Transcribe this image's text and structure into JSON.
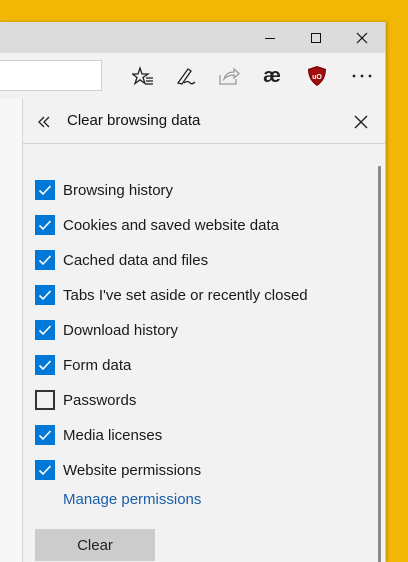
{
  "pane": {
    "title": "Clear browsing data"
  },
  "options": [
    {
      "label": "Browsing history",
      "checked": true
    },
    {
      "label": "Cookies and saved website data",
      "checked": true
    },
    {
      "label": "Cached data and files",
      "checked": true
    },
    {
      "label": "Tabs I've set aside or recently closed",
      "checked": true
    },
    {
      "label": "Download history",
      "checked": true
    },
    {
      "label": "Form data",
      "checked": true
    },
    {
      "label": "Passwords",
      "checked": false
    },
    {
      "label": "Media licenses",
      "checked": true
    },
    {
      "label": "Website permissions",
      "checked": true
    }
  ],
  "manage_link": "Manage permissions",
  "clear_button": "Clear",
  "toolbar": {
    "extension_ae_glyph": "æ"
  },
  "colors": {
    "accent": "#0078d7",
    "link": "#1a5fa8",
    "desktop": "#f2b705"
  }
}
